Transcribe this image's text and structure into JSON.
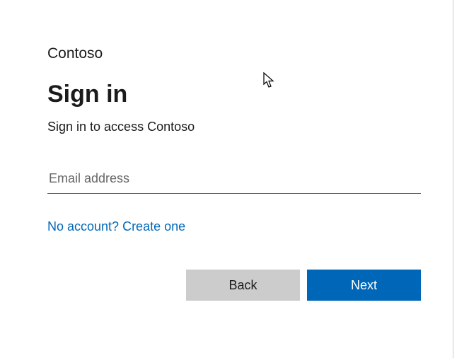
{
  "brand": "Contoso",
  "title": "Sign in",
  "subtitle": "Sign in to access Contoso",
  "email": {
    "placeholder": "Email address",
    "value": ""
  },
  "createAccount": "No account? Create one",
  "buttons": {
    "back": "Back",
    "next": "Next"
  }
}
